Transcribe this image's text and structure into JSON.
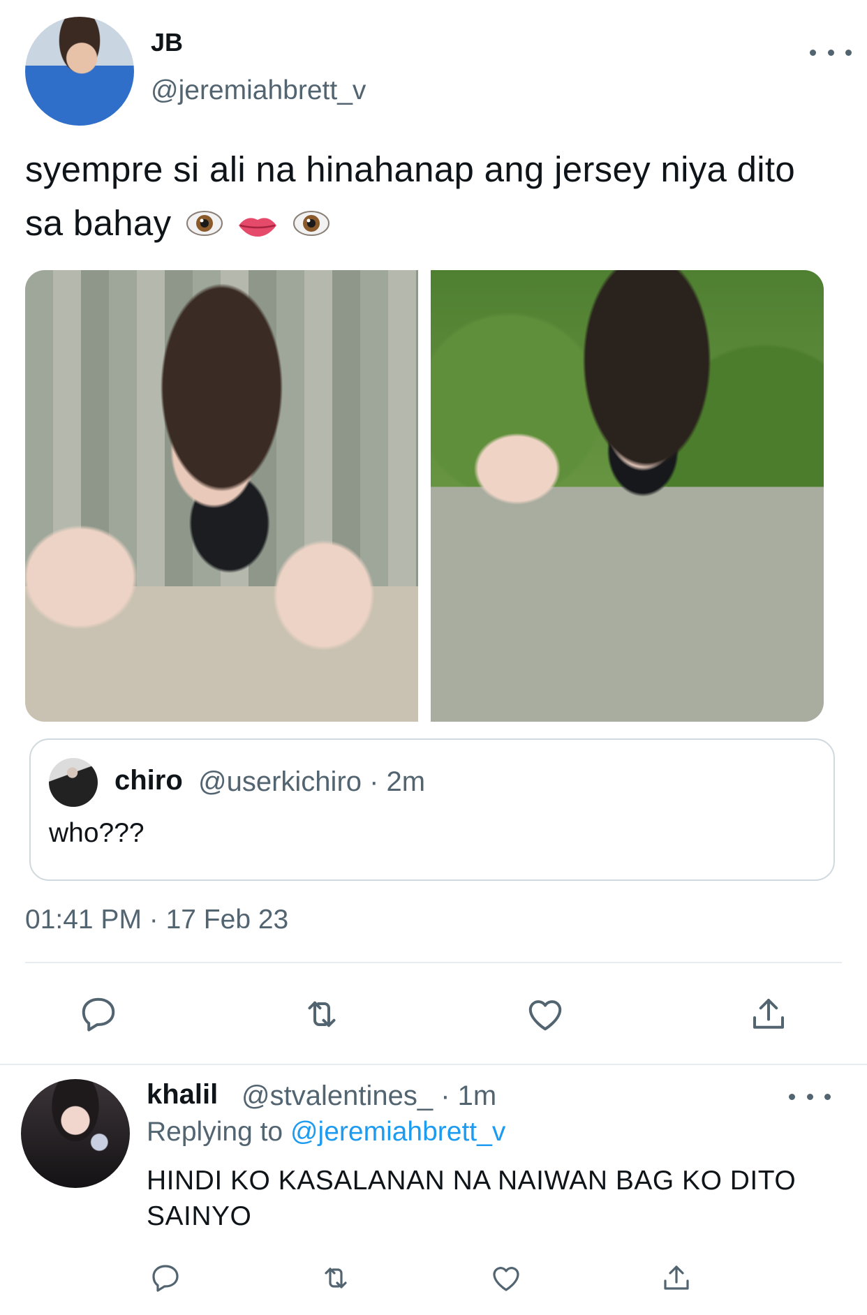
{
  "tweet": {
    "author_name": "JB",
    "author_handle": "@jeremiahbrett_v",
    "text": "syempre si ali na hinahanap ang jersey niya dito sa bahay",
    "emojis": [
      "eye",
      "lips",
      "eye"
    ],
    "timestamp": "01:41 PM · 17 Feb 23"
  },
  "quoted": {
    "name": "chiro",
    "meta": "@userkichiro · 2m",
    "text": "who???"
  },
  "reply": {
    "name": "khalil",
    "meta": "@stvalentines_ · 1m",
    "replying_prefix": "Replying to ",
    "replying_handle": "@jeremiahbrett_v",
    "text": "HINDI KO KASALANAN NA NAIWAN  BAG KO DITO SAINYO"
  },
  "icons": {
    "actions": [
      "reply-icon",
      "retweet-icon",
      "like-icon",
      "share-icon"
    ],
    "more": "more-icon"
  },
  "colors": {
    "text": "#0f1419",
    "secondary": "#536471",
    "link": "#1d9bf0",
    "border": "#cfd9de"
  }
}
